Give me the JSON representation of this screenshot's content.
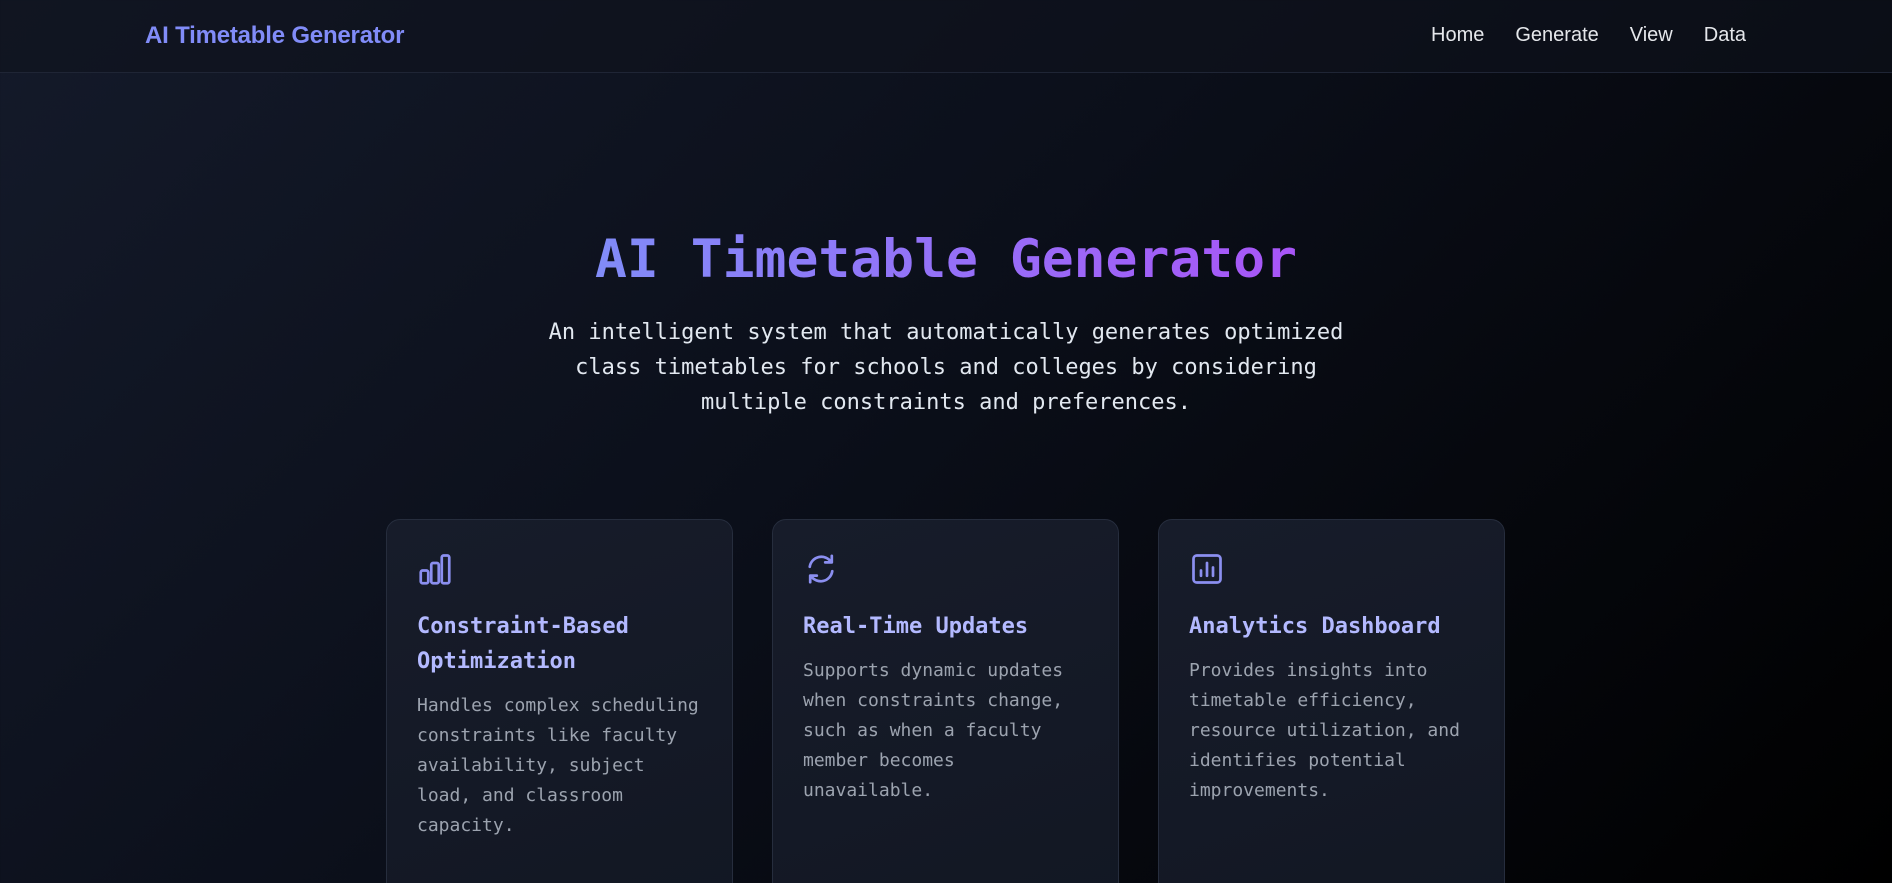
{
  "nav": {
    "brand": "AI Timetable Generator",
    "links": [
      {
        "label": "Home"
      },
      {
        "label": "Generate"
      },
      {
        "label": "View"
      },
      {
        "label": "Data"
      }
    ]
  },
  "hero": {
    "title": "AI Timetable Generator",
    "subtitle": "An intelligent system that automatically generates optimized class timetables for schools and colleges by considering multiple constraints and preferences."
  },
  "features": [
    {
      "icon": "bar-chart-icon",
      "title": "Constraint-Based Optimization",
      "description": "Handles complex scheduling constraints like faculty availability, subject load, and classroom capacity."
    },
    {
      "icon": "refresh-icon",
      "title": "Real-Time Updates",
      "description": "Supports dynamic updates when constraints change, such as when a faculty member becomes unavailable."
    },
    {
      "icon": "analytics-icon",
      "title": "Analytics Dashboard",
      "description": "Provides insights into timetable efficiency, resource utilization, and identifies potential improvements."
    }
  ],
  "colors": {
    "accent": "#818cf8",
    "gradient_end": "#a855f7",
    "card_title": "#b3b9ff",
    "background": "#0b0f1a"
  }
}
